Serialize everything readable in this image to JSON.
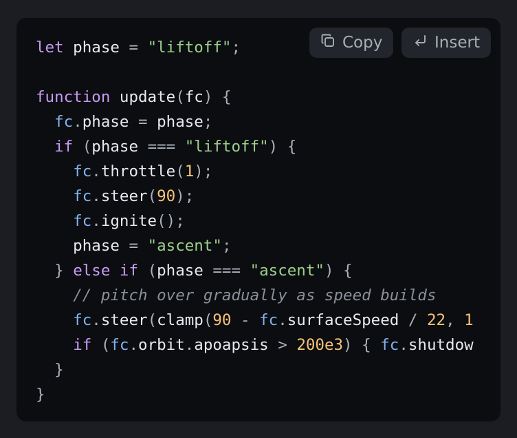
{
  "toolbar": {
    "copy_label": "Copy",
    "insert_label": "Insert",
    "copy_icon": "copy-icon",
    "insert_icon": "return-icon"
  },
  "code": {
    "language": "javascript",
    "lines": [
      [
        [
          "kw",
          "let"
        ],
        [
          "id",
          " phase "
        ],
        [
          "pn",
          "="
        ],
        [
          "id",
          " "
        ],
        [
          "str",
          "\"liftoff\""
        ],
        [
          "pn",
          ";"
        ]
      ],
      [],
      [
        [
          "kw",
          "function"
        ],
        [
          "id",
          " update"
        ],
        [
          "pn",
          "("
        ],
        [
          "id",
          "fc"
        ],
        [
          "pn",
          ") {"
        ]
      ],
      [
        [
          "id",
          "  "
        ],
        [
          "obj",
          "fc"
        ],
        [
          "pn",
          "."
        ],
        [
          "id",
          "phase "
        ],
        [
          "pn",
          "="
        ],
        [
          "id",
          " phase"
        ],
        [
          "pn",
          ";"
        ]
      ],
      [
        [
          "id",
          "  "
        ],
        [
          "kw",
          "if"
        ],
        [
          "id",
          " "
        ],
        [
          "pn",
          "("
        ],
        [
          "id",
          "phase "
        ],
        [
          "pn",
          "==="
        ],
        [
          "id",
          " "
        ],
        [
          "str",
          "\"liftoff\""
        ],
        [
          "pn",
          ") {"
        ]
      ],
      [
        [
          "id",
          "    "
        ],
        [
          "obj",
          "fc"
        ],
        [
          "pn",
          "."
        ],
        [
          "id",
          "throttle"
        ],
        [
          "pn",
          "("
        ],
        [
          "num",
          "1"
        ],
        [
          "pn",
          ");"
        ]
      ],
      [
        [
          "id",
          "    "
        ],
        [
          "obj",
          "fc"
        ],
        [
          "pn",
          "."
        ],
        [
          "id",
          "steer"
        ],
        [
          "pn",
          "("
        ],
        [
          "num",
          "90"
        ],
        [
          "pn",
          ");"
        ]
      ],
      [
        [
          "id",
          "    "
        ],
        [
          "obj",
          "fc"
        ],
        [
          "pn",
          "."
        ],
        [
          "id",
          "ignite"
        ],
        [
          "pn",
          "();"
        ]
      ],
      [
        [
          "id",
          "    phase "
        ],
        [
          "pn",
          "="
        ],
        [
          "id",
          " "
        ],
        [
          "str",
          "\"ascent\""
        ],
        [
          "pn",
          ";"
        ]
      ],
      [
        [
          "id",
          "  "
        ],
        [
          "pn",
          "}"
        ],
        [
          "id",
          " "
        ],
        [
          "kw",
          "else if"
        ],
        [
          "id",
          " "
        ],
        [
          "pn",
          "("
        ],
        [
          "id",
          "phase "
        ],
        [
          "pn",
          "==="
        ],
        [
          "id",
          " "
        ],
        [
          "str",
          "\"ascent\""
        ],
        [
          "pn",
          ") {"
        ]
      ],
      [
        [
          "id",
          "    "
        ],
        [
          "cm",
          "// pitch over gradually as speed builds"
        ]
      ],
      [
        [
          "id",
          "    "
        ],
        [
          "obj",
          "fc"
        ],
        [
          "pn",
          "."
        ],
        [
          "id",
          "steer"
        ],
        [
          "pn",
          "("
        ],
        [
          "id",
          "clamp"
        ],
        [
          "pn",
          "("
        ],
        [
          "num",
          "90"
        ],
        [
          "id",
          " "
        ],
        [
          "pn",
          "-"
        ],
        [
          "id",
          " "
        ],
        [
          "obj",
          "fc"
        ],
        [
          "pn",
          "."
        ],
        [
          "id",
          "surfaceSpeed "
        ],
        [
          "pn",
          "/"
        ],
        [
          "id",
          " "
        ],
        [
          "num",
          "22"
        ],
        [
          "pn",
          ", "
        ],
        [
          "num",
          "1"
        ]
      ],
      [
        [
          "id",
          "    "
        ],
        [
          "kw",
          "if"
        ],
        [
          "id",
          " "
        ],
        [
          "pn",
          "("
        ],
        [
          "obj",
          "fc"
        ],
        [
          "pn",
          "."
        ],
        [
          "id",
          "orbit"
        ],
        [
          "pn",
          "."
        ],
        [
          "id",
          "apoapsis "
        ],
        [
          "pn",
          ">"
        ],
        [
          "id",
          " "
        ],
        [
          "num",
          "200e3"
        ],
        [
          "pn",
          ") {"
        ],
        [
          "id",
          " "
        ],
        [
          "obj",
          "fc"
        ],
        [
          "pn",
          "."
        ],
        [
          "id",
          "shutdow"
        ]
      ],
      [
        [
          "id",
          "  "
        ],
        [
          "pn",
          "}"
        ]
      ],
      [
        [
          "pn",
          "}"
        ]
      ]
    ]
  }
}
